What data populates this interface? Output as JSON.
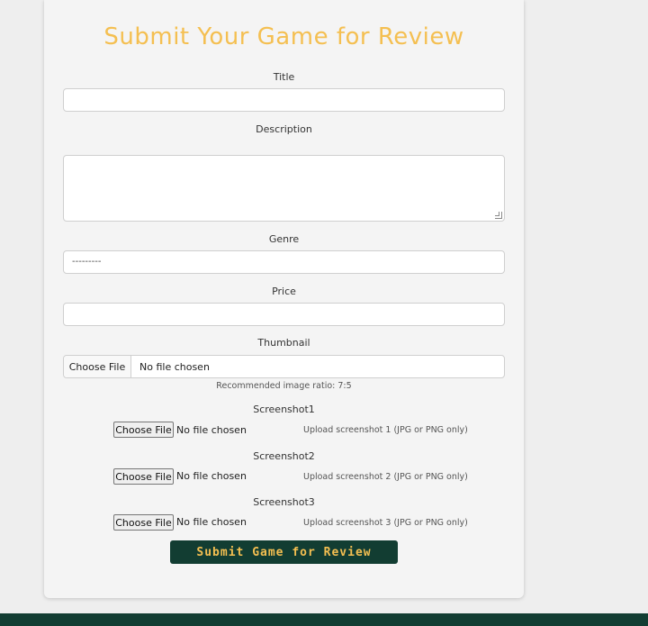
{
  "form": {
    "title": "Submit Your Game for Review",
    "fields": {
      "title_label": "Title",
      "title_value": "",
      "description_label": "Description",
      "description_value": "",
      "genre_label": "Genre",
      "genre_selected": "---------",
      "price_label": "Price",
      "price_value": "",
      "thumbnail_label": "Thumbnail",
      "thumbnail_button": "Choose File",
      "thumbnail_status": "No file chosen",
      "thumbnail_hint": "Recommended image ratio: 7:5"
    },
    "screenshots": [
      {
        "label": "Screenshot1",
        "button": "Choose File",
        "status": "No file chosen",
        "hint": "Upload screenshot 1 (JPG or PNG only)"
      },
      {
        "label": "Screenshot2",
        "button": "Choose File",
        "status": "No file chosen",
        "hint": "Upload screenshot 2 (JPG or PNG only)"
      },
      {
        "label": "Screenshot3",
        "button": "Choose File",
        "status": "No file chosen",
        "hint": "Upload screenshot 3 (JPG or PNG only)"
      }
    ],
    "submit_label": "Submit Game for Review"
  },
  "colors": {
    "accent": "#f4bf51",
    "dark_green": "#123d32",
    "card_bg": "#f4f4f4",
    "page_bg": "#eeeeee"
  }
}
